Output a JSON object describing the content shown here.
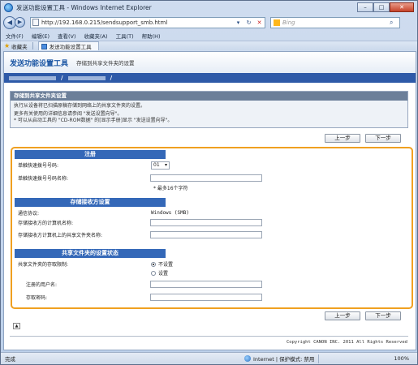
{
  "window": {
    "title": "发送功能设置工具 - Windows Internet Explorer",
    "controls": {
      "minimize": "–",
      "maximize": "□",
      "close": "✕"
    }
  },
  "address_bar": {
    "url": "http://192.168.0.215/sendsupport_smb.html",
    "search_placeholder": "Bing"
  },
  "menu": [
    "文件(F)",
    "编辑(E)",
    "查看(V)",
    "收藏夹(A)",
    "工具(T)",
    "帮助(H)"
  ],
  "favorites": {
    "label": "收藏夹",
    "tab_title": "发送功能设置工具"
  },
  "page": {
    "title": "发送功能设置工具",
    "subtitle": "存储到共享文件夹的设置",
    "crumb_sep": "/"
  },
  "description": {
    "heading": "存储到共享文件夹设置",
    "line1": "执行从设备将已扫描原稿存储到网络上的共享文件夹的设置。",
    "line2": "更多有关使用的详细信息请参阅 \"发送设置向导\"。",
    "line3": "* 可以从启动工具的 \"CD-ROM数据\" 的[显示手册]显示 \"发送设置向导\"。"
  },
  "buttons": {
    "back": "上一步",
    "next": "下一步"
  },
  "sections": {
    "register": {
      "heading": "注册",
      "speed_dial_label": "单触快速拨号号码:",
      "speed_dial_value": "01",
      "name_label": "单触快速拨号号码名称:",
      "name_hint": "* 最多16个字符"
    },
    "destination": {
      "heading": "存储接收方设置",
      "protocol_label": "通信协议:",
      "protocol_value": "Windows (SMB)",
      "computer_label": "存储接收方的计算机名称:",
      "folder_label": "存储接收方计算机上的共享文件夹名称:"
    },
    "sharing": {
      "heading": "共享文件夹的设置状态",
      "restriction_label": "共享文件夹的存取限制:",
      "option_off": "不设置",
      "option_on": "设置",
      "username_label": "注册的用户名:",
      "password_label": "存取密码:"
    }
  },
  "footer": {
    "copyright": "Copyright CANON INC. 2011 All Rights Reserved"
  },
  "status": {
    "left": "完成",
    "zone": "Internet | 保护模式: 禁用",
    "zoom": "100%"
  }
}
